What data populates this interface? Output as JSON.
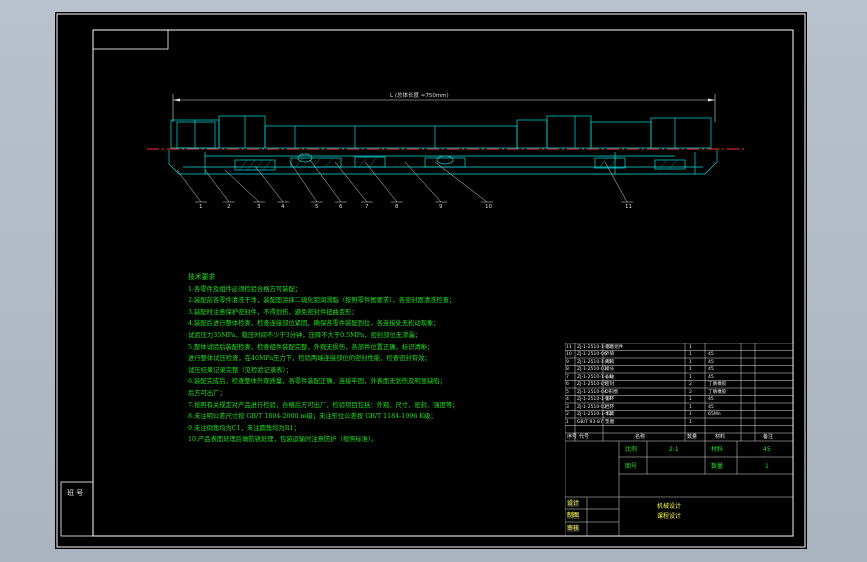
{
  "drawing": {
    "dimension_label": "L (总体长度 ≈750mm)",
    "item_numbers": [
      "1",
      "2",
      "3",
      "4",
      "5",
      "6",
      "7",
      "8",
      "9",
      "10",
      "11"
    ]
  },
  "notes": {
    "title": "技术要求",
    "lines": [
      "1.各零件及组件必须检验合格方可装配；",
      "2.装配前各零件清洗干净，装配面涂抹二硫化钼润滑脂（按照零件图要求），各密封面清洗检查；",
      "3.装配时注意保护密封件，不得划伤，避免密封件扭曲变形；",
      "4.装配后进行整体检查，检查连接部位紧固，确保各零件装配到位，各连接处无松动现象；",
      "试验压力35MPa，稳压时间不少于3分钟，压降不大于0.5MPa，密封部位无渗漏；",
      "5.整体试验后装配检查，检查组件装配完整，外观无损伤，各部件位置正确，标识清晰；",
      "进行整体试压检查，在40MPa压力下，检验两端连接部位的密封性能，检查密封有效；",
      "试压结果记录完整（见检验记录表）；",
      "6.装配完成后，检查整体外观质量，各零件装配正确，连接牢固，外表面无划伤及明显缺陷；",
      "后方可出厂；",
      "7.按照有关规定对产品进行检验，合格后方可出厂，检验项目包括：外观、尺寸、密封、强度等；",
      "8.未注明公差尺寸按 GB/T 1804-2000 m级；未注形位公差按 GB/T 1184-1996 K级；",
      "9.未注倒角均为C1，未注圆角均为R1；",
      "10.产品表面处理后做防锈处理，包装运输时注意防护（按照标准）。"
    ]
  },
  "side_label": "班 号",
  "title_block": {
    "rows": [
      {
        "no": "11",
        "code": "ZJ-1-2510-1-00",
        "name": "活塞组件",
        "qty": "1",
        "mat": ""
      },
      {
        "no": "10",
        "code": "ZJ-1-2510-06",
        "name": "外筒",
        "qty": "1",
        "mat": "45"
      },
      {
        "no": "9",
        "code": "ZJ-1-2510-1-05",
        "name": "内筒",
        "qty": "1",
        "mat": "45"
      },
      {
        "no": "8",
        "code": "ZJ-1-2510-03",
        "name": "接头",
        "qty": "1",
        "mat": "45"
      },
      {
        "no": "7",
        "code": "ZJ-1-2510-1-04",
        "name": "心轴",
        "qty": "1",
        "mat": "45"
      },
      {
        "no": "6",
        "code": "ZJ-1-2510-05",
        "name": "密封",
        "qty": "2",
        "mat": "丁腈橡胶"
      },
      {
        "no": "5",
        "code": "ZJ-1-2510-04",
        "name": "O形圈",
        "qty": "2",
        "mat": "丁腈橡胶"
      },
      {
        "no": "4",
        "code": "ZJ-1-2510-1-03",
        "name": "垫环",
        "qty": "1",
        "mat": "45"
      },
      {
        "no": "3",
        "code": "ZJ-1-2510-02",
        "name": "挡环",
        "qty": "1",
        "mat": "45"
      },
      {
        "no": "2",
        "code": "ZJ-1-2510-1-02",
        "name": "卡簧",
        "qty": "1",
        "mat": "65Mn"
      },
      {
        "no": "1",
        "code": "GB/T 93-87",
        "name": "垫圈",
        "qty": "1",
        "mat": ""
      }
    ],
    "header": {
      "no": "序号",
      "code": "代号",
      "name": "名称",
      "qty": "数量",
      "mat": "材料",
      "note": "备注"
    },
    "ratio_label": "比例",
    "ratio_value": "2:1",
    "material_label": "材料",
    "material_value": "45",
    "drawing_no_label": "图号",
    "quantity_label": "数量",
    "quantity_value": "1",
    "design_label": "设计",
    "draw_label": "制图",
    "review_label": "审核",
    "title_line1": "机械设计",
    "title_line2": "课程设计"
  },
  "colors": {
    "border": "#ffffff",
    "outline": "#00e0e0",
    "centerline": "#ff3030",
    "text": "#20e020",
    "leader": "#ffffff"
  }
}
